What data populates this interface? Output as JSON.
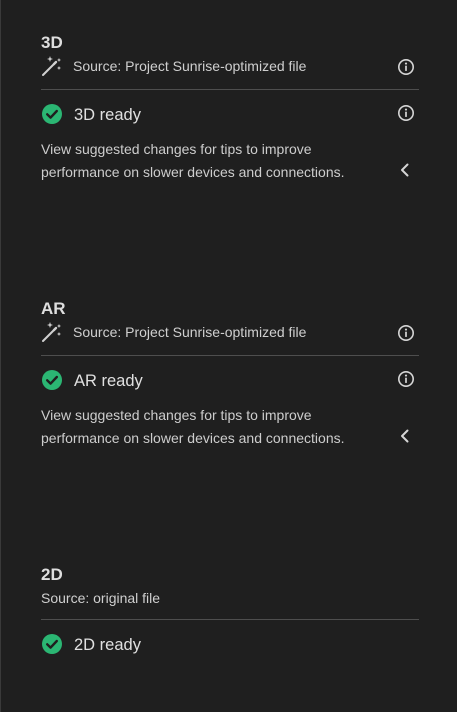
{
  "sections": [
    {
      "title": "3D",
      "source_text": "Source: Project Sunrise-optimized file",
      "source_icon": "wand-sparkle-icon",
      "status_text": "3D ready",
      "status_icon": "check-circle-icon",
      "status_color": "#2bb673",
      "tip_text": "View suggested changes for tips to improve performance on slower devices and connections."
    },
    {
      "title": "AR",
      "source_text": "Source: Project Sunrise-optimized file",
      "source_icon": "wand-sparkle-icon",
      "status_text": "AR ready",
      "status_icon": "check-circle-icon",
      "status_color": "#2bb673",
      "tip_text": "View suggested changes for tips to improve performance on slower devices and connections."
    },
    {
      "title": "2D",
      "source_text": "Source: original file",
      "status_text": "2D ready",
      "status_icon": "check-circle-icon",
      "status_color": "#2bb673"
    }
  ],
  "colors": {
    "background": "#1f1f1f",
    "divider": "#4e4e4e",
    "success": "#2bb673"
  }
}
